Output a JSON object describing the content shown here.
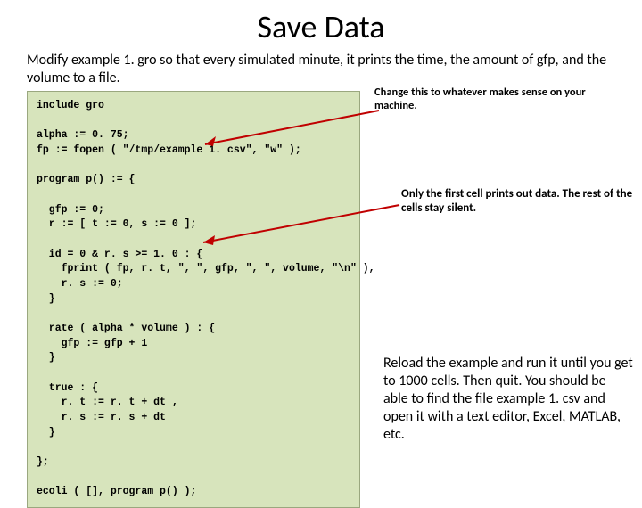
{
  "title": "Save Data",
  "intro": "Modify example 1. gro so that every simulated minute, it prints the time, the amount of gfp, and the volume to a file.",
  "code": "include gro\n\nalpha := 0. 75;\nfp := fopen ( \"/tmp/example 1. csv\", \"w\" );\n\nprogram p() := {\n\n  gfp := 0;\n  r := [ t := 0, s := 0 ];\n\n  id = 0 & r. s >= 1. 0 : {\n    fprint ( fp, r. t, \", \", gfp, \", \", volume, \"\\n\" ),\n    r. s := 0;\n  }\n\n  rate ( alpha * volume ) : {\n    gfp := gfp + 1\n  }\n\n  true : {\n    r. t := r. t + dt ,\n    r. s := r. s + dt\n  }\n\n};\n\necoli ( [], program p() );",
  "notes": {
    "change_path": "Change this to whatever makes sense on your machine.",
    "first_cell": "Only the first cell prints out data. The rest of the cells stay silent.",
    "reload": "Reload the example and run it until you get to 1000 cells. Then quit. You should be able to find the file example 1. csv and open it with a text editor, Excel, MATLAB, etc."
  }
}
